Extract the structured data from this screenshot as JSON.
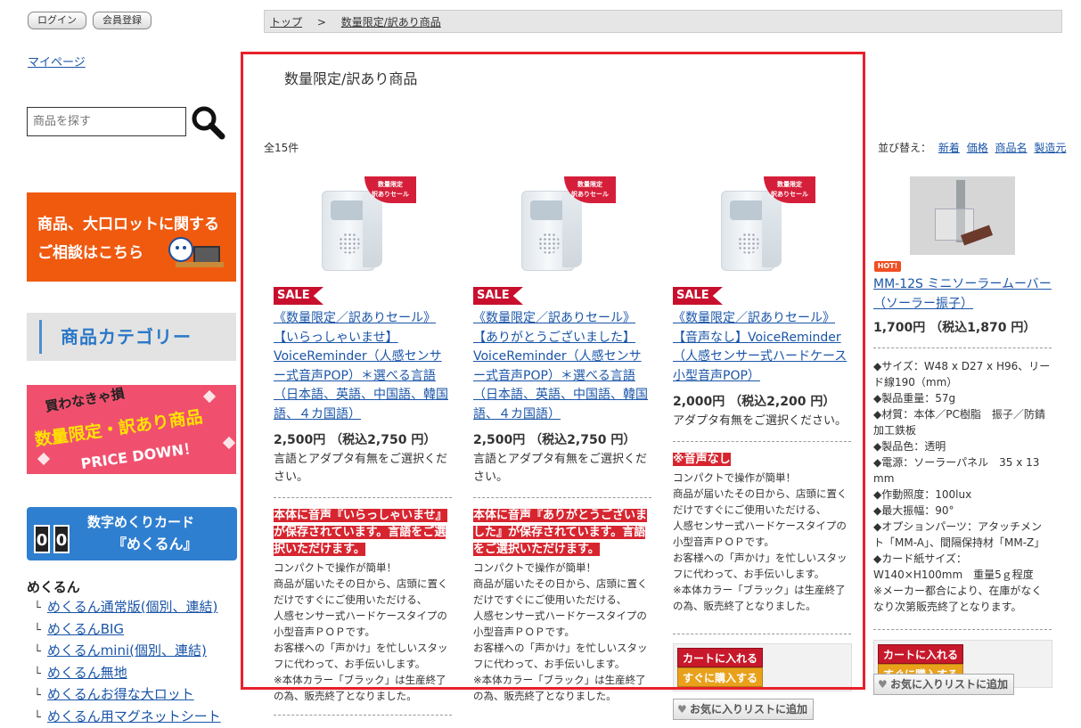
{
  "auth": {
    "login": "ログイン",
    "register": "会員登録"
  },
  "sidebar": {
    "mypage": "マイページ",
    "search_placeholder": "商品を探す",
    "banner_consult": [
      "商品、大口ロットに関する",
      "ご相談はこちら"
    ],
    "banner_category": "商品カテゴリー",
    "banner_sale": [
      "買わなきゃ損",
      "数量限定・訳あり商品",
      "PRICE DOWN！"
    ],
    "banner_mekurun": {
      "line1": "数字めくりカード",
      "line2": "『めくるん』",
      "digits": [
        "0",
        "0"
      ]
    },
    "mekurun_heading": "めくるん",
    "mekurun_links": [
      "めくるん通常版(個別、連結)",
      "めくるんBIG",
      "めくるんmini(個別、連結)",
      "めくるん無地",
      "めくるんお得な大ロット",
      "めくるん用マグネットシート"
    ]
  },
  "breadcrumb": {
    "home": "トップ",
    "separator": ">",
    "current": "数量限定/訳あり商品"
  },
  "main": {
    "title": "数量限定/訳あり商品",
    "count": "全15件",
    "sort_label": "並び替え：",
    "sort_options": [
      "新着",
      "価格",
      "商品名",
      "製造元"
    ]
  },
  "products": [
    {
      "ribbon": "数量限定\n訳ありセール",
      "sale": "SALE",
      "name": "《数量限定／訳ありセール》【いらっしゃいませ】VoiceReminder（人感センサー式音声POP）＊選べる言語（日本語、英語、中国語、韓国語、４カ国語）",
      "price": "2,500円 （税込2,750 円）",
      "note": "言語とアダプタ有無をご選択ください。",
      "label": "本体に音声『いらっしゃいませ』が保存されています。言語をご選択いただけます。",
      "desc": "コンパクトで操作が簡単！\n商品が届いたその日から、店頭に置くだけですぐにご使用いただける、\n人感センサー式ハードケースタイプの小型音声ＰＯＰです。\nお客様への「声かけ」を忙しいスタッフに代わって、お手伝いします。\n※本体カラー「ブラック」は生産終了の為、販売終了となりました。"
    },
    {
      "ribbon": "数量限定\n訳ありセール",
      "sale": "SALE",
      "name": "《数量限定／訳ありセール》【ありがとうございました】VoiceReminder（人感センサー式音声POP）＊選べる言語（日本語、英語、中国語、韓国語、４カ国語）",
      "price": "2,500円 （税込2,750 円）",
      "note": "言語とアダプタ有無をご選択ください。",
      "label": "本体に音声『ありがとうございました』が保存されています。言語をご選択いただけます。",
      "desc": "コンパクトで操作が簡単！\n商品が届いたその日から、店頭に置くだけですぐにご使用いただける、\n人感センサー式ハードケースタイプの小型音声ＰＯＰです。\nお客様への「声かけ」を忙しいスタッフに代わって、お手伝いします。\n※本体カラー「ブラック」は生産終了の為、販売終了となりました。"
    },
    {
      "ribbon": "数量限定\n訳ありセール",
      "sale": "SALE",
      "name": "《数量限定／訳ありセール》【音声なし】VoiceReminder（人感センサー式ハードケース小型音声POP）",
      "price": "2,000円 （税込2,200 円）",
      "note": "アダプタ有無をご選択ください。",
      "label": "※音声なし",
      "desc": "コンパクトで操作が簡単！\n商品が届いたその日から、店頭に置くだけですぐにご使用いただける、\n人感センサー式ハードケースタイプの小型音声ＰＯＰです。\nお客様への「声かけ」を忙しいスタッフに代わって、お手伝いします。\n※本体カラー「ブラック」は生産終了の為、販売終了となりました。",
      "cart": "カートに入れる",
      "buy": "すぐに購入する",
      "fav": "お気に入りリストに追加"
    }
  ],
  "right_product": {
    "badge": "HOT!",
    "name": "MM-12S ミニソーラームーバー（ソーラー振子）",
    "price": "1,700円 （税込1,870 円）",
    "specs": [
      "◆サイズ：W48 x D27 x H96、リード線190（mm）",
      "◆製品重量：57g",
      "◆材質：本体／PC樹脂　振子／防錆加工鉄板",
      "◆製品色：透明",
      "◆電源：ソーラーパネル　35 x 13 mm",
      "◆作動照度：100lux",
      "◆最大振幅：90°",
      "◆オプションパーツ：アタッチメント「MM-A」、間隔保持材「MM-Z」",
      "◆カード紙サイズ：W140×H100mm　重量5ｇ程度",
      "※メーカー都合により、在庫がなくなり次第販売終了となります。"
    ],
    "cart": "カートに入れる",
    "buy": "すぐに購入する",
    "fav": "お気に入りリストに追加"
  },
  "colors": {
    "highlight": "#e8212a",
    "link": "#1a55a8",
    "sale": "#c8102e",
    "consult_banner": "#f05a0f",
    "mekurun_banner": "#2f7fd0"
  }
}
